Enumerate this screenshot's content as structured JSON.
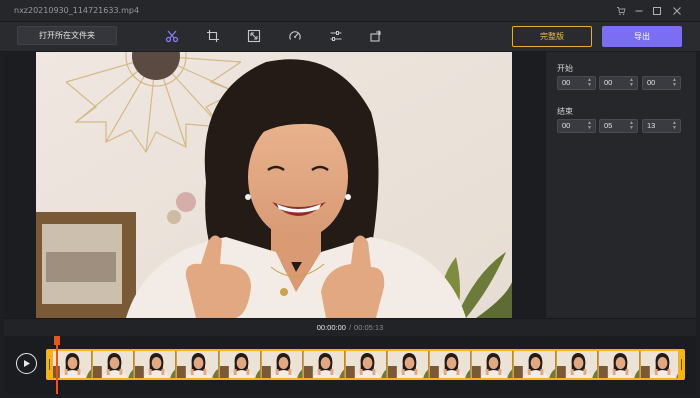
{
  "window": {
    "title": "nxz20210930_114721633.mp4"
  },
  "toolbar": {
    "open_folder": "打开所在文件夹",
    "tools": [
      "scissors-icon",
      "crop-icon",
      "resize-icon",
      "speed-icon",
      "adjust-icon",
      "rotate-icon"
    ],
    "pro_label": "完整版",
    "export_label": "导出"
  },
  "side_panel": {
    "start_label": "开始",
    "start": [
      "00",
      "00",
      "00"
    ],
    "end_label": "结束",
    "end": [
      "00",
      "05",
      "13"
    ]
  },
  "playback": {
    "current": "00:00:00",
    "separator": "/",
    "total": "00:05:13"
  },
  "timeline": {
    "frame_count": 15
  },
  "colors": {
    "accent": "#7b6ef5",
    "pro_border": "#e1b12c",
    "timeline_border": "#f5b21b",
    "playhead": "#e2571e"
  }
}
